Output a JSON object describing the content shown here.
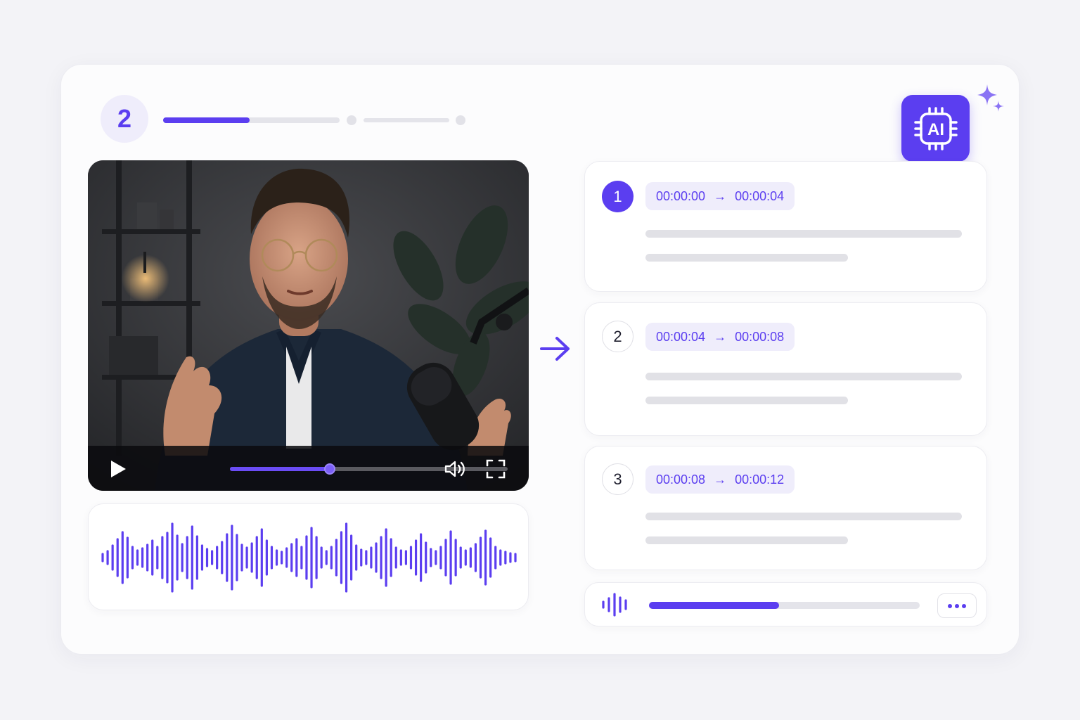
{
  "step": {
    "number": "2",
    "progress_fraction": 0.49
  },
  "ai_badge": {
    "label": "AI",
    "icon": "ai-chip-icon"
  },
  "video": {
    "scene": "man-speaking-into-microphone",
    "played_fraction": 0.36,
    "controls": {
      "play": "play-icon",
      "volume": "volume-icon",
      "fullscreen": "fullscreen-icon"
    }
  },
  "segments": [
    {
      "number": "1",
      "start": "00:00:00",
      "end": "00:00:04",
      "active": true
    },
    {
      "number": "2",
      "start": "00:00:04",
      "end": "00:00:08",
      "active": false
    },
    {
      "number": "3",
      "start": "00:00:08",
      "end": "00:00:12",
      "active": false
    }
  ],
  "segment_arrow": "→",
  "audio": {
    "progress_fraction": 0.48,
    "icon": "waveform-icon",
    "menu_icon": "more-icon"
  },
  "colors": {
    "accent": "#5b3ef0",
    "accent_soft": "#efedfb",
    "background": "#f3f3f7",
    "line": "#e1e1e6"
  }
}
